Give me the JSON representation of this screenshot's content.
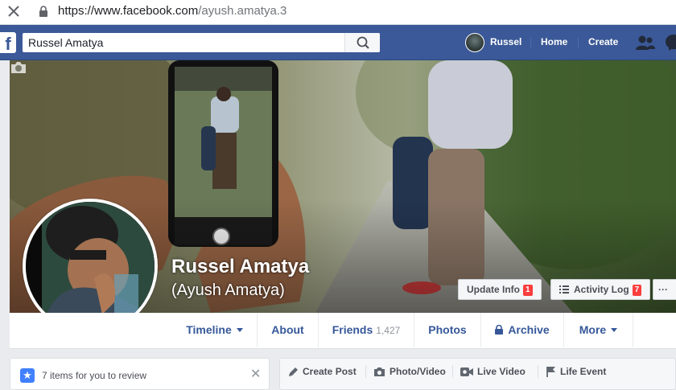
{
  "browser": {
    "url_main": "https://www.facebook.com",
    "url_path": "/ayush.amatya.3"
  },
  "topnav": {
    "search_value": "Russel Amatya",
    "profile_name": "Russel",
    "home": "Home",
    "create": "Create"
  },
  "profile": {
    "name": "Russel Amatya",
    "alternate_name": "(Ayush Amatya)"
  },
  "cover_buttons": {
    "update_info": "Update Info",
    "update_info_badge": "1",
    "activity_log": "Activity Log",
    "activity_log_badge": "7",
    "more": "···"
  },
  "tabs": {
    "timeline": "Timeline",
    "about": "About",
    "friends": "Friends",
    "friends_count": "1,427",
    "photos": "Photos",
    "archive": "Archive",
    "more": "More"
  },
  "review_card": {
    "text": "7 items for you to review"
  },
  "composer": {
    "create_post": "Create Post",
    "photo_video": "Photo/Video",
    "live_video": "Live Video",
    "life_event": "Life Event"
  },
  "colors": {
    "fb_blue": "#3b5998",
    "link_blue": "#365899",
    "badge_red": "#fa3e3e"
  }
}
